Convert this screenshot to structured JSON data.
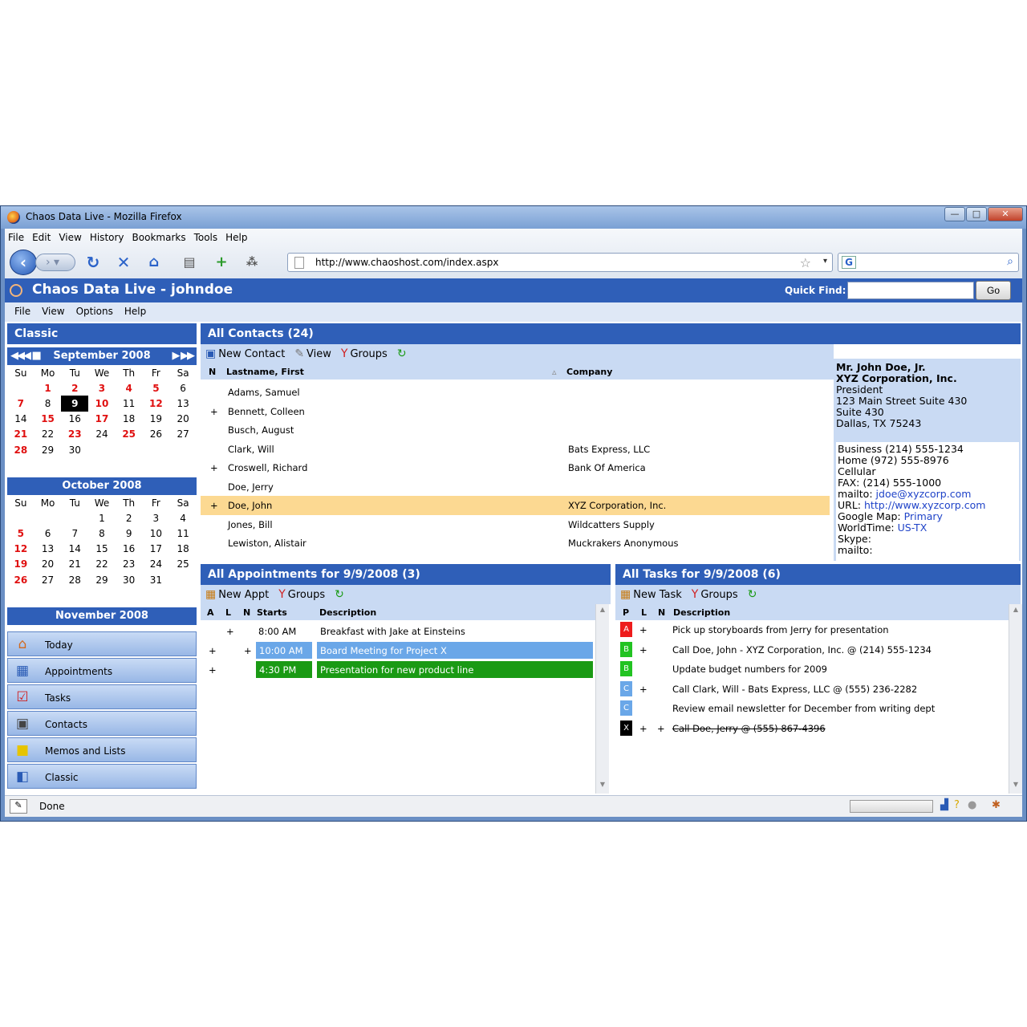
{
  "window": {
    "title": "Chaos Data Live - Mozilla Firefox",
    "btn_min": "—",
    "btn_max": "□",
    "btn_close": "✕"
  },
  "browser_menu": [
    "File",
    "Edit",
    "View",
    "History",
    "Bookmarks",
    "Tools",
    "Help"
  ],
  "address": {
    "url": "http://www.chaoshost.com/index.aspx"
  },
  "app": {
    "title": "Chaos Data Live - johndoe",
    "quick_find_label": "Quick Find:",
    "go_label": "Go",
    "menu": [
      "File",
      "View",
      "Options",
      "Help"
    ]
  },
  "sidebar": {
    "header": "Classic",
    "calendars": [
      {
        "title": "September 2008",
        "dow": [
          "Su",
          "Mo",
          "Tu",
          "We",
          "Th",
          "Fr",
          "Sa"
        ],
        "weeks": [
          [
            "",
            "1",
            "2",
            "3",
            "4",
            "5",
            "6"
          ],
          [
            "7",
            "8",
            "9",
            "10",
            "11",
            "12",
            "13"
          ],
          [
            "14",
            "15",
            "16",
            "17",
            "18",
            "19",
            "20"
          ],
          [
            "21",
            "22",
            "23",
            "24",
            "25",
            "26",
            "27"
          ],
          [
            "28",
            "29",
            "30",
            "",
            "",
            "",
            ""
          ],
          [
            "",
            "",
            "",
            "",
            "",
            "",
            ""
          ]
        ]
      },
      {
        "title": "October 2008",
        "dow": [
          "Su",
          "Mo",
          "Tu",
          "We",
          "Th",
          "Fr",
          "Sa"
        ],
        "weeks": [
          [
            "",
            "",
            "",
            "1",
            "2",
            "3",
            "4"
          ],
          [
            "5",
            "6",
            "7",
            "8",
            "9",
            "10",
            "11"
          ],
          [
            "12",
            "13",
            "14",
            "15",
            "16",
            "17",
            "18"
          ],
          [
            "19",
            "20",
            "21",
            "22",
            "23",
            "24",
            "25"
          ],
          [
            "26",
            "27",
            "28",
            "29",
            "30",
            "31",
            ""
          ],
          [
            "",
            "",
            "",
            "",
            "",
            "",
            ""
          ]
        ]
      }
    ],
    "nov_title": "November 2008",
    "nav": [
      {
        "label": "Today",
        "icon": "house-icon"
      },
      {
        "label": "Appointments",
        "icon": "calendar-icon"
      },
      {
        "label": "Tasks",
        "icon": "checklist-icon"
      },
      {
        "label": "Contacts",
        "icon": "contact-card-icon"
      },
      {
        "label": "Memos and Lists",
        "icon": "memo-icon"
      },
      {
        "label": "Classic",
        "icon": "classic-icon"
      }
    ]
  },
  "contacts": {
    "header": "All Contacts (24)",
    "toolbar": {
      "new_contact": "New Contact",
      "view": "View",
      "groups": "Groups"
    },
    "cols": {
      "n": "N",
      "name": "Lastname, First",
      "company": "Company"
    },
    "rows": [
      {
        "n": "",
        "name": "Adams, Samuel",
        "company": ""
      },
      {
        "n": "+",
        "name": "Bennett, Colleen",
        "company": ""
      },
      {
        "n": "",
        "name": "Busch, August",
        "company": ""
      },
      {
        "n": "",
        "name": "Clark, Will",
        "company": "Bats Express, LLC"
      },
      {
        "n": "+",
        "name": "Croswell, Richard",
        "company": "Bank Of America"
      },
      {
        "n": "",
        "name": "Doe, Jerry",
        "company": ""
      },
      {
        "n": "+",
        "name": "Doe, John",
        "company": "XYZ Corporation, Inc."
      },
      {
        "n": "",
        "name": "Jones, Bill",
        "company": "Wildcatters Supply"
      },
      {
        "n": "",
        "name": "Lewiston, Alistair",
        "company": "Muckrakers Anonymous"
      }
    ],
    "detail": {
      "name": "Mr. John Doe, Jr.",
      "company": "XYZ Corporation, Inc.",
      "title": "President",
      "addr1": "123 Main Street Suite 430",
      "addr2": "Suite 430",
      "addr3": "Dallas, TX 75243",
      "business": "Business (214) 555-1234",
      "home": "Home (972) 555-8976",
      "cellular": "Cellular",
      "fax": "FAX: (214) 555-1000",
      "mailto_label": "mailto:",
      "mailto": "jdoe@xyzcorp.com",
      "url_label": "URL:",
      "url": "http://www.xyzcorp.com",
      "gmap_label": "Google Map:",
      "gmap": "Primary",
      "worldtime_label": "WorldTime:",
      "worldtime": "US-TX",
      "skype": "Skype:",
      "mailto2": "mailto:"
    }
  },
  "appointments": {
    "header": "All Appointments for 9/9/2008 (3)",
    "toolbar": {
      "new_appt": "New Appt",
      "groups": "Groups"
    },
    "cols": {
      "a": "A",
      "l": "L",
      "n": "N",
      "starts": "Starts",
      "desc": "Description"
    },
    "rows": [
      {
        "a": "",
        "l": "+",
        "n": "",
        "starts": "8:00 AM",
        "desc": "Breakfast with Jake at Einsteins",
        "color": ""
      },
      {
        "a": "+",
        "l": "",
        "n": "+",
        "starts": "10:00 AM",
        "desc": "Board Meeting for Project X",
        "color": "#6aa7e8"
      },
      {
        "a": "+",
        "l": "",
        "n": "",
        "starts": "4:30 PM",
        "desc": "Presentation for new product line",
        "color": "#1a9a14"
      }
    ]
  },
  "tasks": {
    "header": "All Tasks for 9/9/2008 (6)",
    "toolbar": {
      "new_task": "New Task",
      "groups": "Groups"
    },
    "cols": {
      "p": "P",
      "l": "L",
      "n": "N",
      "desc": "Description"
    },
    "rows": [
      {
        "p": "A",
        "pcolor": "#ee1c1c",
        "l": "+",
        "n": "",
        "desc": "Pick up storyboards from Jerry for presentation",
        "done": false
      },
      {
        "p": "B",
        "pcolor": "#22c322",
        "l": "+",
        "n": "",
        "desc": "Call Doe, John - XYZ Corporation, Inc. @ (214) 555-1234",
        "done": false
      },
      {
        "p": "B",
        "pcolor": "#22c322",
        "l": "",
        "n": "",
        "desc": "Update budget numbers for 2009",
        "done": false
      },
      {
        "p": "C",
        "pcolor": "#6aa7e8",
        "l": "+",
        "n": "",
        "desc": "Call Clark, Will - Bats Express, LLC @ (555) 236-2282",
        "done": false
      },
      {
        "p": "C",
        "pcolor": "#6aa7e8",
        "l": "",
        "n": "",
        "desc": "Review email newsletter for December from writing dept",
        "done": false
      },
      {
        "p": "X",
        "pcolor": "#000000",
        "l": "+",
        "n": "+",
        "desc": "Call Doe, Jerry @ (555) 867-4396",
        "done": true
      }
    ]
  },
  "status": {
    "text": "Done"
  },
  "colors": {
    "header_blue": "#2f5fb8",
    "toolbar_blue": "#c9daf3",
    "selected_row": "#fcd992",
    "calendar_red": "#e01010"
  }
}
